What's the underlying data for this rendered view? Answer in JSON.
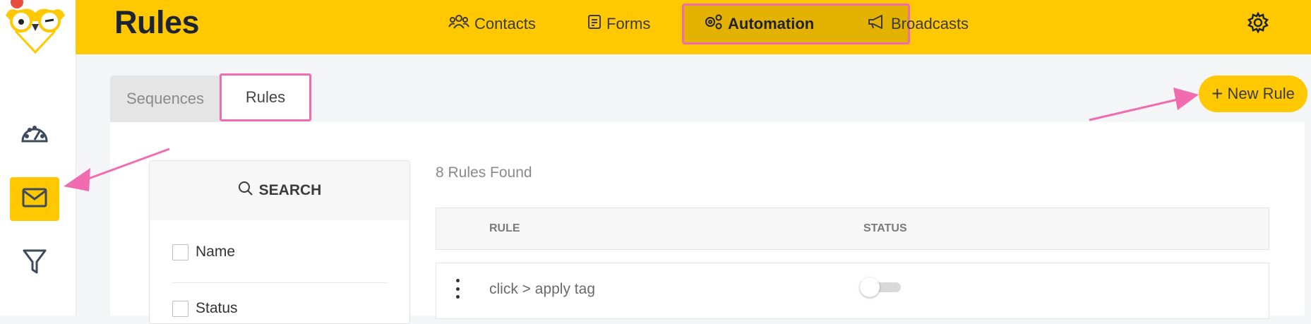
{
  "header": {
    "title": "Rules",
    "nav": [
      {
        "label": "Contacts",
        "icon": "users-icon"
      },
      {
        "label": "Forms",
        "icon": "form-icon"
      },
      {
        "label": "Automation",
        "icon": "gears-icon",
        "active": true
      },
      {
        "label": "Broadcasts",
        "icon": "megaphone-icon"
      }
    ],
    "settings_icon": "gear-icon"
  },
  "sidebar": {
    "items": [
      {
        "icon": "dashboard-icon"
      },
      {
        "icon": "envelope-icon",
        "active": true
      },
      {
        "icon": "filter-icon"
      }
    ]
  },
  "tabs": [
    {
      "label": "Sequences",
      "active": false
    },
    {
      "label": "Rules",
      "active": true
    }
  ],
  "new_rule": {
    "label": "New Rule"
  },
  "search": {
    "title": "SEARCH",
    "filters": [
      {
        "label": "Name"
      },
      {
        "label": "Status"
      }
    ]
  },
  "rules_count": "8 Rules Found",
  "table": {
    "headers": [
      "RULE",
      "STATUS"
    ],
    "rows": [
      {
        "name": "click > apply tag",
        "status_on": false
      }
    ]
  },
  "colors": {
    "brand_yellow": "#ffc800",
    "highlight_pink": "#f06bb0",
    "active_nav": "#e3b200"
  }
}
